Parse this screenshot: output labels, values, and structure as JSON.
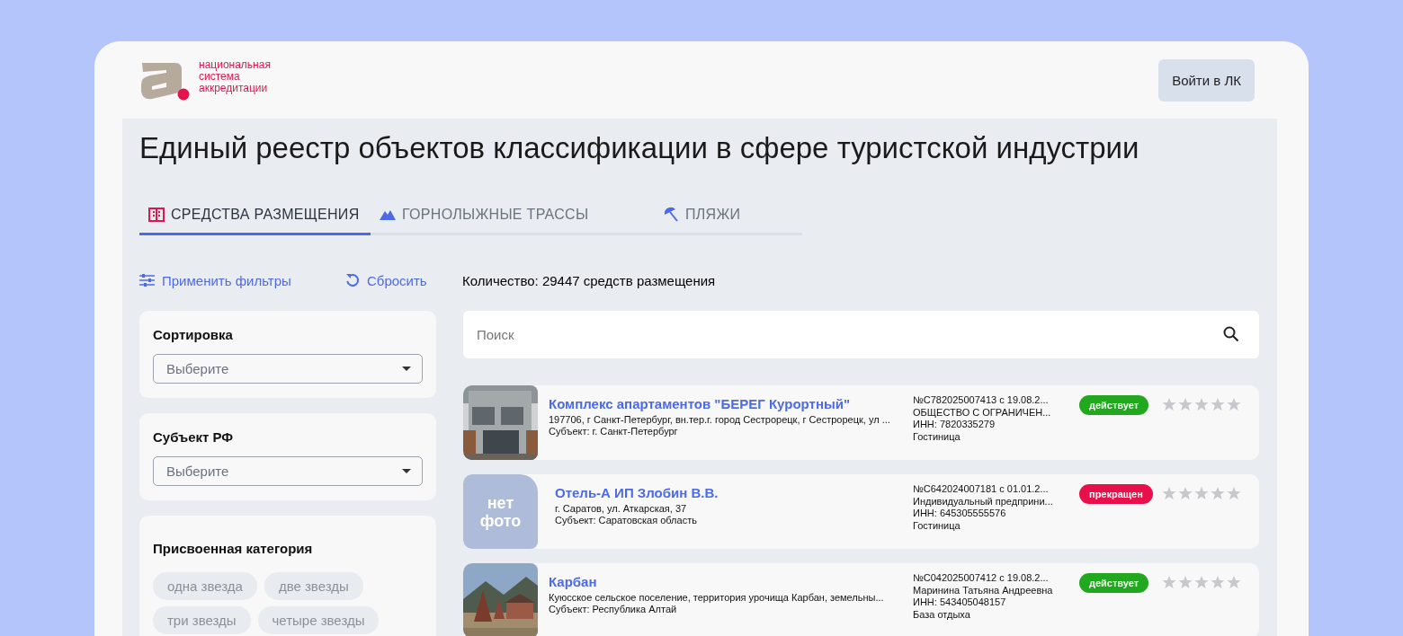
{
  "header": {
    "logo_lines": [
      "национальная",
      "система",
      "аккредитации"
    ],
    "login_button": "Войти в ЛК"
  },
  "title": "Единый реестр объектов классификации в сфере туристской индустрии",
  "tabs": [
    {
      "label": "СРЕДСТВА РАЗМЕЩЕНИЯ",
      "kind": "building",
      "selected": true
    },
    {
      "label": "ГОРНОЛЫЖНЫЕ ТРАССЫ",
      "kind": "mountain",
      "selected": false
    },
    {
      "label": "ПЛЯЖИ",
      "kind": "umbrella",
      "selected": false
    }
  ],
  "toolbar": {
    "apply": "Применить фильтры",
    "reset": "Сбросить",
    "count": "Количество: 29447 средств размещения"
  },
  "filters": [
    {
      "kind": "select",
      "title": "Сортировка",
      "placeholder": "Выберите"
    },
    {
      "kind": "select",
      "title": "Субъект РФ",
      "placeholder": "Выберите"
    },
    {
      "kind": "chips",
      "title": "Присвоенная категория",
      "chips": [
        "одна звезда",
        "две звезды",
        "три звезды",
        "четыре звезды"
      ]
    }
  ],
  "search": {
    "placeholder": "Поиск"
  },
  "results": [
    {
      "name": "Комплекс апартаментов \"БЕРЕГ Курортный\"",
      "address": "197706, г Санкт-Петербург, вн.тер.г. город Сестрорецк, г Сестрорецк, ул ...",
      "subject": "Субъект: г. Санкт-Петербург",
      "registry": [
        "№С782025007413 с 19.08.2...",
        "ОБЩЕСТВО С ОГРАНИЧЕН...",
        "ИНН: 7820335279",
        "Гостиница"
      ],
      "status": "действует",
      "color": "#22a81e",
      "stars": 0
    },
    {
      "image": {
        "kind": "placeholder",
        "text": [
          "нет",
          "фото"
        ]
      },
      "name": "Отель-А ИП Злобин В.В.",
      "address": "г. Саратов, ул. Аткарская, 37",
      "subject": "Субъект: Саратовская область",
      "registry": [
        "№С642024007181 с 01.01.2...",
        "Индивидуальный предприни...",
        "ИНН: 645305555576",
        "Гостиница"
      ],
      "status": "прекращен",
      "color": "#e8104a",
      "stars": 0
    },
    {
      "name": "Карбан",
      "address": "Куюсское сельское поселение, территория урочища Карбан, земельны...",
      "subject": "Субъект: Республика Алтай",
      "registry": [
        "№С042025007412 с 19.08.2...",
        "Маринина Татьяна Андреевна",
        "ИНН: 543405048157",
        "База отдыха"
      ],
      "status": "действует",
      "color": "#22a81e",
      "stars": 0
    }
  ]
}
